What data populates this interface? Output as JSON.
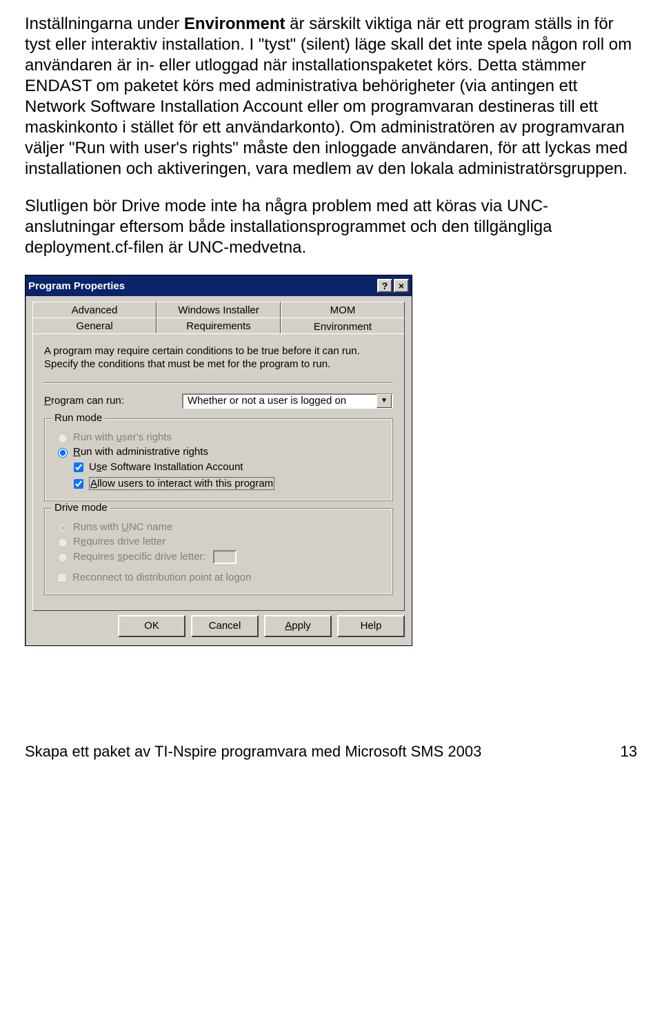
{
  "doc": {
    "p1_a": "Inställningarna under ",
    "p1_b": "Environment",
    "p1_c": " är särskilt viktiga när ett program ställs in för tyst eller interaktiv installation. I \"tyst\" (silent) läge skall det inte spela någon roll om användaren är in- eller utloggad när installationspaketet körs. Detta stämmer ENDAST om paketet körs med administrativa behörigheter (via antingen ett Network Software Installation Account eller om programvaran destineras till ett maskinkonto i stället för ett användarkonto). Om administratören av programvaran väljer \"Run with user's rights\" måste den inloggade användaren, för att lyckas med installationen och aktiveringen, vara medlem av den lokala administratörsgruppen.",
    "p2": "Slutligen bör Drive mode inte ha några problem med att köras via UNC-anslutningar eftersom både installationsprogrammet och den tillgängliga deployment.cf-filen är UNC-medvetna."
  },
  "dialog": {
    "title": "Program Properties",
    "tabs_back": [
      "Advanced",
      "Windows Installer",
      "MOM"
    ],
    "tabs_front": [
      "General",
      "Requirements",
      "Environment"
    ],
    "desc": "A program may require certain conditions to be true before it can run. Specify the conditions that must be met for the program to run.",
    "program_can_run_label": "Program can run:",
    "program_can_run_value": "Whether or not a user is logged on",
    "run_mode": {
      "legend": "Run mode",
      "user_rights": "Run with user's rights",
      "admin_rights": "Run with administrative rights",
      "use_sia": "Use Software Installation Account",
      "allow_interact": "Allow users to interact with this program"
    },
    "drive_mode": {
      "legend": "Drive mode",
      "unc": "Runs with UNC name",
      "drive_letter": "Requires drive letter",
      "specific": "Requires specific drive letter:",
      "reconnect": "Reconnect to distribution point at logon"
    },
    "buttons": {
      "ok": "OK",
      "cancel": "Cancel",
      "apply": "Apply",
      "help": "Help"
    }
  },
  "footer": {
    "text": "Skapa ett paket av TI-Nspire programvara med Microsoft SMS 2003",
    "page": "13"
  }
}
